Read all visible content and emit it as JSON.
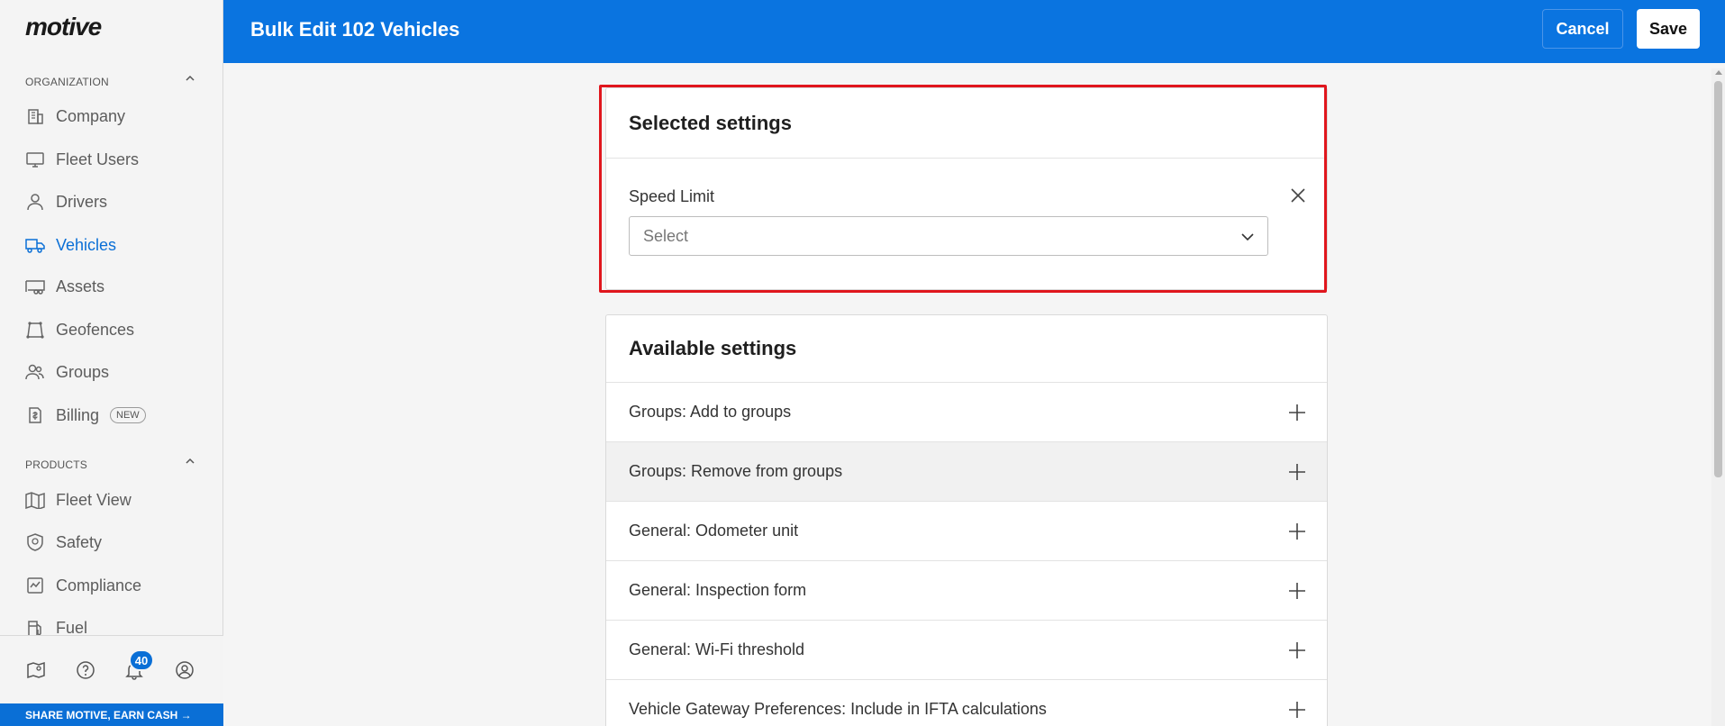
{
  "sidebar": {
    "logo": "motive",
    "organization_label": "ORGANIZATION",
    "organization_items": [
      {
        "label": "Company",
        "icon": "building-icon"
      },
      {
        "label": "Fleet Users",
        "icon": "monitor-icon"
      },
      {
        "label": "Drivers",
        "icon": "person-icon"
      },
      {
        "label": "Vehicles",
        "icon": "truck-icon",
        "active": true
      },
      {
        "label": "Assets",
        "icon": "trailer-icon"
      },
      {
        "label": "Geofences",
        "icon": "geofence-icon"
      },
      {
        "label": "Groups",
        "icon": "group-icon"
      },
      {
        "label": "Billing",
        "icon": "billing-icon",
        "badge": "NEW"
      }
    ],
    "products_label": "PRODUCTS",
    "product_items": [
      {
        "label": "Fleet View",
        "icon": "map-icon"
      },
      {
        "label": "Safety",
        "icon": "shield-icon"
      },
      {
        "label": "Compliance",
        "icon": "compliance-icon"
      },
      {
        "label": "Fuel",
        "icon": "fuel-icon"
      }
    ],
    "notification_count": "40",
    "share_banner": "SHARE MOTIVE, EARN CASH →"
  },
  "header": {
    "title": "Bulk Edit 102 Vehicles",
    "cancel_label": "Cancel",
    "save_label": "Save"
  },
  "selected_settings": {
    "title": "Selected settings",
    "field_label": "Speed Limit",
    "select_placeholder": "Select"
  },
  "available_settings": {
    "title": "Available settings",
    "items": [
      "Groups: Add to groups",
      "Groups: Remove from groups",
      "General: Odometer unit",
      "General: Inspection form",
      "General: Wi-Fi threshold",
      "Vehicle Gateway Preferences: Include in IFTA calculations"
    ]
  },
  "colors": {
    "header_blue": "#0a74e0",
    "active_blue": "#0a6fd6",
    "highlight_red": "#e0161d"
  }
}
